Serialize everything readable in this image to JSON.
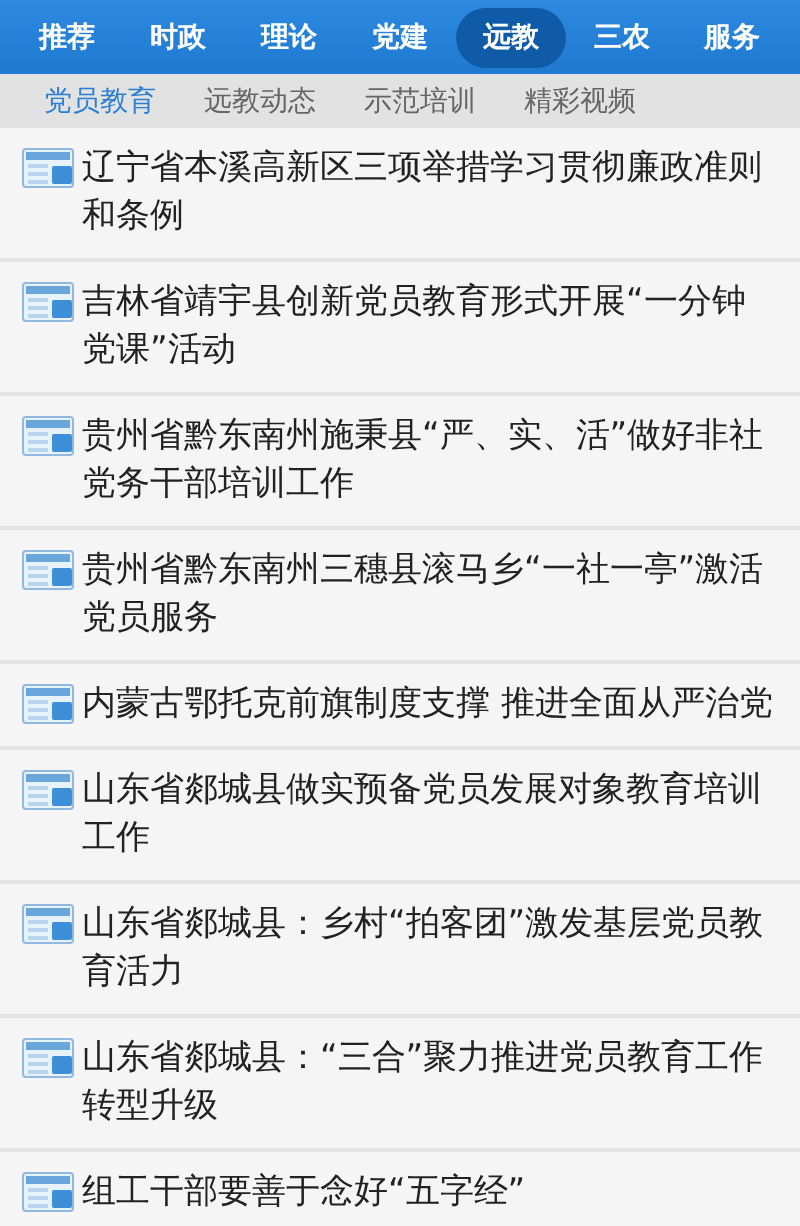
{
  "tabs": [
    {
      "label": "推荐",
      "selected": false
    },
    {
      "label": "时政",
      "selected": false
    },
    {
      "label": "理论",
      "selected": false
    },
    {
      "label": "党建",
      "selected": false
    },
    {
      "label": "远教",
      "selected": true
    },
    {
      "label": "三农",
      "selected": false
    },
    {
      "label": "服务",
      "selected": false
    }
  ],
  "subtabs": [
    {
      "label": "党员教育",
      "selected": true
    },
    {
      "label": "远教动态",
      "selected": false
    },
    {
      "label": "示范培训",
      "selected": false
    },
    {
      "label": "精彩视频",
      "selected": false
    }
  ],
  "articles": [
    {
      "title": "辽宁省本溪高新区三项举措学习贯彻廉政准则和条例"
    },
    {
      "title": "吉林省靖宇县创新党员教育形式开展“一分钟党课”活动"
    },
    {
      "title": "贵州省黔东南州施秉县“严、实、活”做好非社党务干部培训工作"
    },
    {
      "title": "贵州省黔东南州三穗县滚马乡“一社一亭”激活党员服务"
    },
    {
      "title": "内蒙古鄂托克前旗制度支撑 推进全面从严治党"
    },
    {
      "title": "山东省郯城县做实预备党员发展对象教育培训工作"
    },
    {
      "title": "山东省郯城县：乡村“拍客团”激发基层党员教育活力"
    },
    {
      "title": "山东省郯城县：“三合”聚力推进党员教育工作转型升级"
    },
    {
      "title": "组工干部要善于念好“五字经”"
    }
  ]
}
